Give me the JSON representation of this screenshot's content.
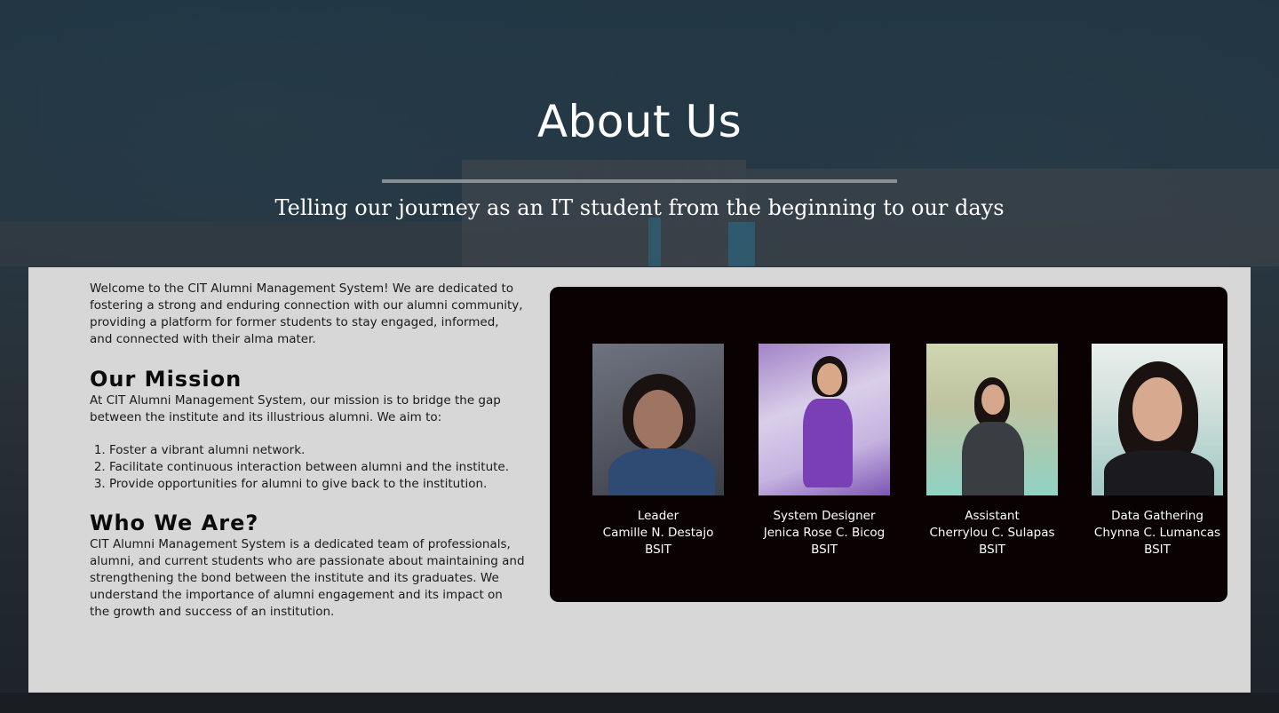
{
  "hero": {
    "title": "About Us",
    "subtitle": "Telling our journey as an IT student from the beginning to our days"
  },
  "about": {
    "intro": "Welcome to the CIT Alumni Management System! We are dedicated to fostering a strong and enduring connection with our alumni community, providing a platform for former students to stay engaged, informed, and connected with their alma mater.",
    "mission": {
      "heading": "Our Mission",
      "text": "At CIT Alumni Management System, our mission is to bridge the gap between the institute and its illustrious alumni. We aim to:",
      "items": [
        "Foster a vibrant alumni network.",
        "Facilitate continuous interaction between alumni and the institute.",
        "Provide opportunities for alumni to give back to the institution."
      ]
    },
    "who": {
      "heading": "Who We Are?",
      "text": "CIT Alumni Management System is a dedicated team of professionals, alumni, and current students who are passionate about maintaining and strengthening the bond between the institute and its graduates. We understand the importance of alumni engagement and its impact on the growth and success of an institution."
    }
  },
  "team": [
    {
      "role": "Leader",
      "name": "Camille N. Destajo",
      "course": "BSIT"
    },
    {
      "role": "System Designer",
      "name": "Jenica Rose C. Bicog",
      "course": "BSIT"
    },
    {
      "role": "Assistant",
      "name": "Cherrylou C. Sulapas",
      "course": "BSIT"
    },
    {
      "role": "Data Gathering",
      "name": "Chynna C. Lumancas",
      "course": "BSIT"
    }
  ],
  "colors": {
    "panel": "#d7d7d7",
    "team_card": "#0a0202",
    "hero_rule": "#8a8f93"
  }
}
